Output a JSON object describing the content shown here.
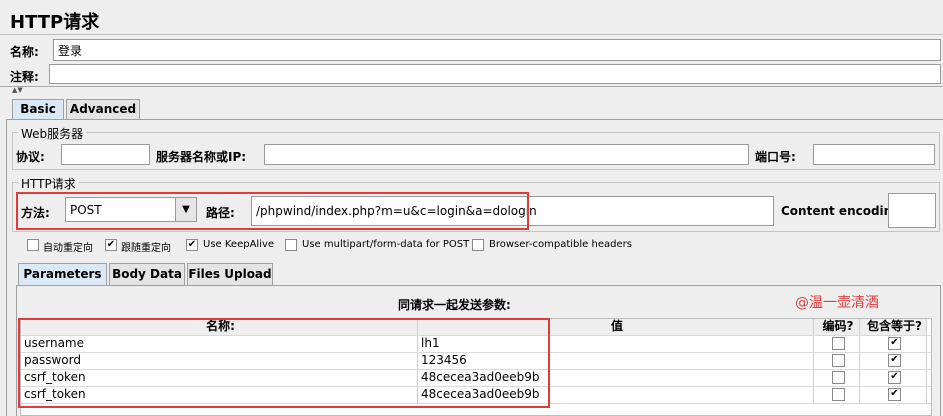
{
  "page_title": "HTTP请求",
  "name_label": "名称:",
  "name_value": "登录",
  "comment_label": "注释:",
  "comment_value": "",
  "tabs": [
    {
      "label": "Basic"
    },
    {
      "label": "Advanced"
    }
  ],
  "web_server": {
    "legend": "Web服务器",
    "protocol_label": "协议:",
    "protocol_value": "",
    "server_label": "服务器名称或IP:",
    "server_value": "",
    "port_label": "端口号:",
    "port_value": ""
  },
  "http_request": {
    "legend": "HTTP请求",
    "method_label": "方法:",
    "method_value": "POST",
    "path_label": "路径:",
    "path_value": "/phpwind/index.php?m=u&c=login&a=dologin",
    "encoding_label": "Content encoding:",
    "encoding_value": ""
  },
  "options": [
    {
      "label": "自动重定向",
      "checked": false
    },
    {
      "label": "跟随重定向",
      "checked": true
    },
    {
      "label": "Use KeepAlive",
      "checked": true
    },
    {
      "label": "Use multipart/form-data for POST",
      "checked": false
    },
    {
      "label": "Browser-compatible headers",
      "checked": false
    }
  ],
  "param_tabs": [
    {
      "label": "Parameters"
    },
    {
      "label": "Body Data"
    },
    {
      "label": "Files Upload"
    }
  ],
  "params_title": "同请求一起发送参数:",
  "watermark": "@温一壶清酒",
  "table": {
    "headers": [
      "名称:",
      "值",
      "编码?",
      "包含等于?"
    ],
    "rows": [
      {
        "name": "username",
        "value": "lh1",
        "encode": false,
        "include_equals": true
      },
      {
        "name": "password",
        "value": "123456",
        "encode": false,
        "include_equals": true
      },
      {
        "name": "csrf_token",
        "value": "48cecea3ad0eeb9b",
        "encode": false,
        "include_equals": true
      },
      {
        "name": "csrf_token",
        "value": "48cecea3ad0eeb9b",
        "encode": false,
        "include_equals": true
      }
    ]
  },
  "colors": {
    "highlight_red": "#e03a3a",
    "watermark": "#e04040",
    "active_tab": "#dbe8f5"
  }
}
